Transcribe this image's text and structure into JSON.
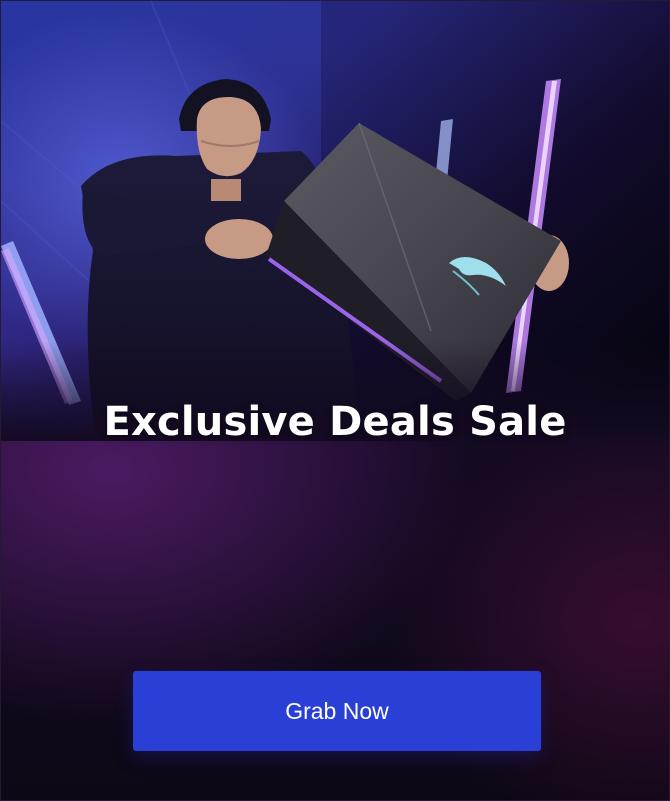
{
  "banner": {
    "title": "Exclusive Deals Sale",
    "cta_label": "Grab Now"
  },
  "hero_image": {
    "subject": "person-holding-laptop",
    "logo_icon": "republic-of-gamers-logo-icon"
  },
  "colors": {
    "button": "#2a3fd6",
    "title_text": "#ffffff",
    "background": "#140a22",
    "neon_purple": "#b24bff",
    "neon_blue": "#4c78ff"
  }
}
